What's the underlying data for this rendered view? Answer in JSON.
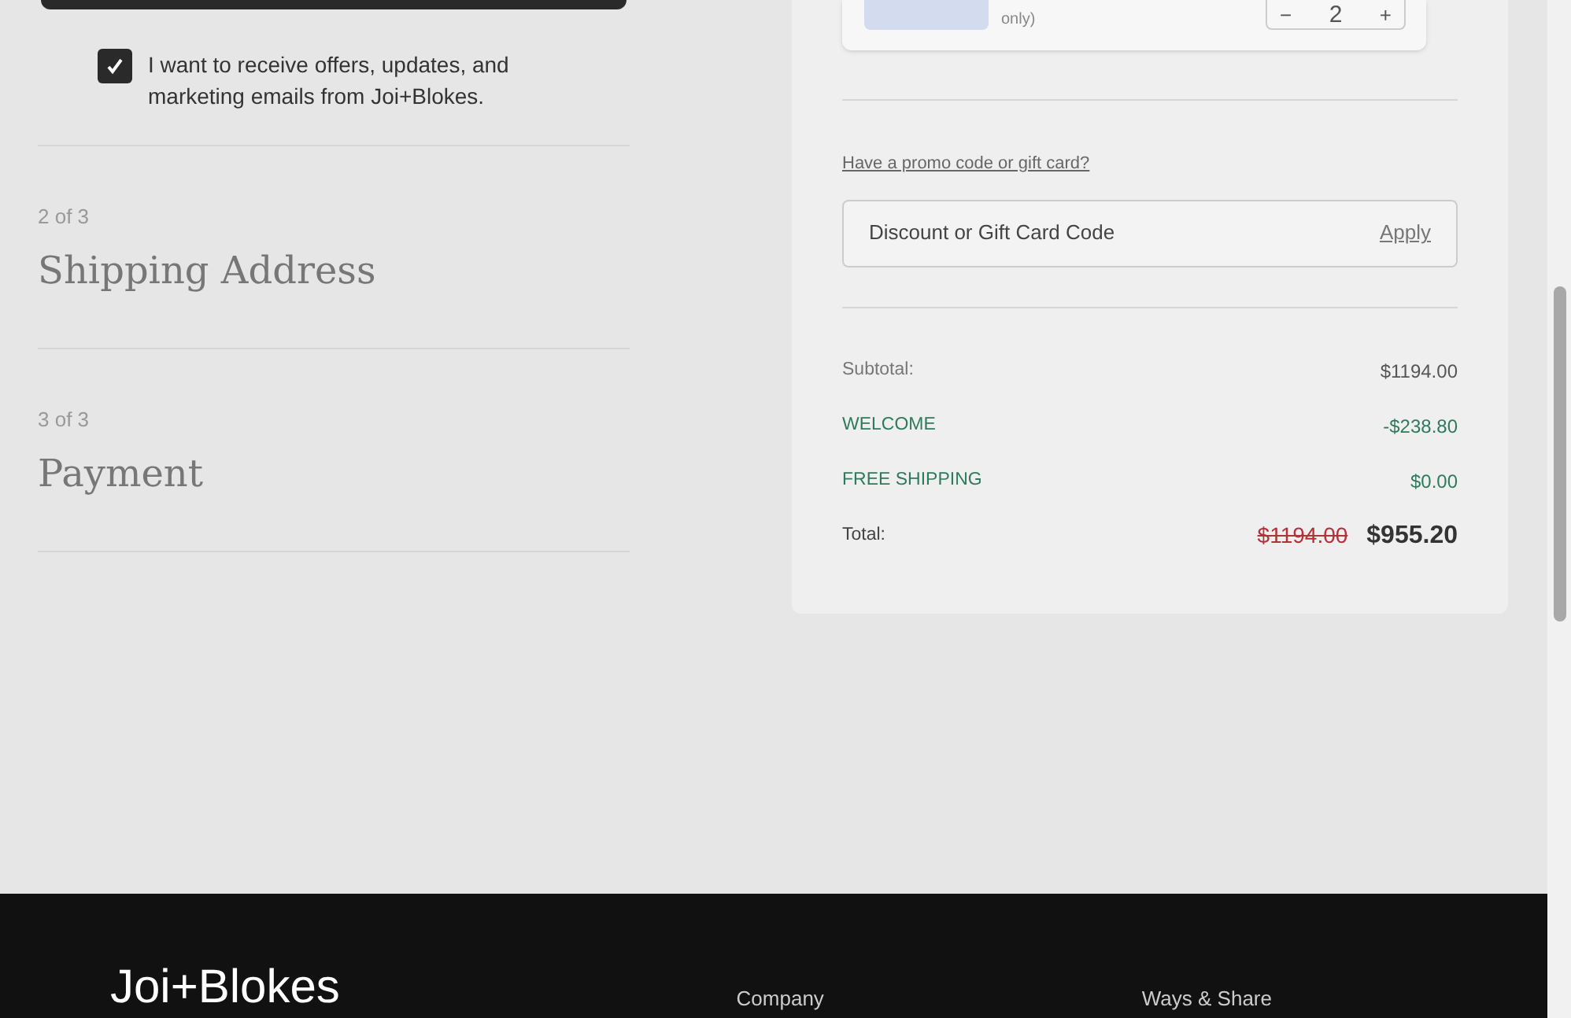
{
  "marketing_opt_in": {
    "checked": true,
    "label": "I want to receive offers, updates, and marketing emails from Joi+Blokes."
  },
  "steps": [
    {
      "step": "2 of 3",
      "title": "Shipping Address"
    },
    {
      "step": "3 of 3",
      "title": "Payment"
    }
  ],
  "cart_item": {
    "note": "only)",
    "quantity": "2",
    "decrement": "−",
    "increment": "+"
  },
  "promo": {
    "link": "Have a promo code or gift card?",
    "placeholder": "Discount or Gift Card Code",
    "apply": "Apply"
  },
  "summary": [
    {
      "kind": "plain",
      "label": "Subtotal:",
      "value": "$1194.00"
    },
    {
      "kind": "discount",
      "label": "WELCOME",
      "value": "-$238.80"
    },
    {
      "kind": "discount",
      "label": "FREE SHIPPING",
      "value": "$0.00"
    },
    {
      "kind": "total",
      "label": "Total:",
      "old_value": "$1194.00",
      "value": "$955.20"
    }
  ],
  "footer": {
    "logo": "Joi+Blokes",
    "columns": [
      "Company",
      "Ways & Share"
    ]
  }
}
